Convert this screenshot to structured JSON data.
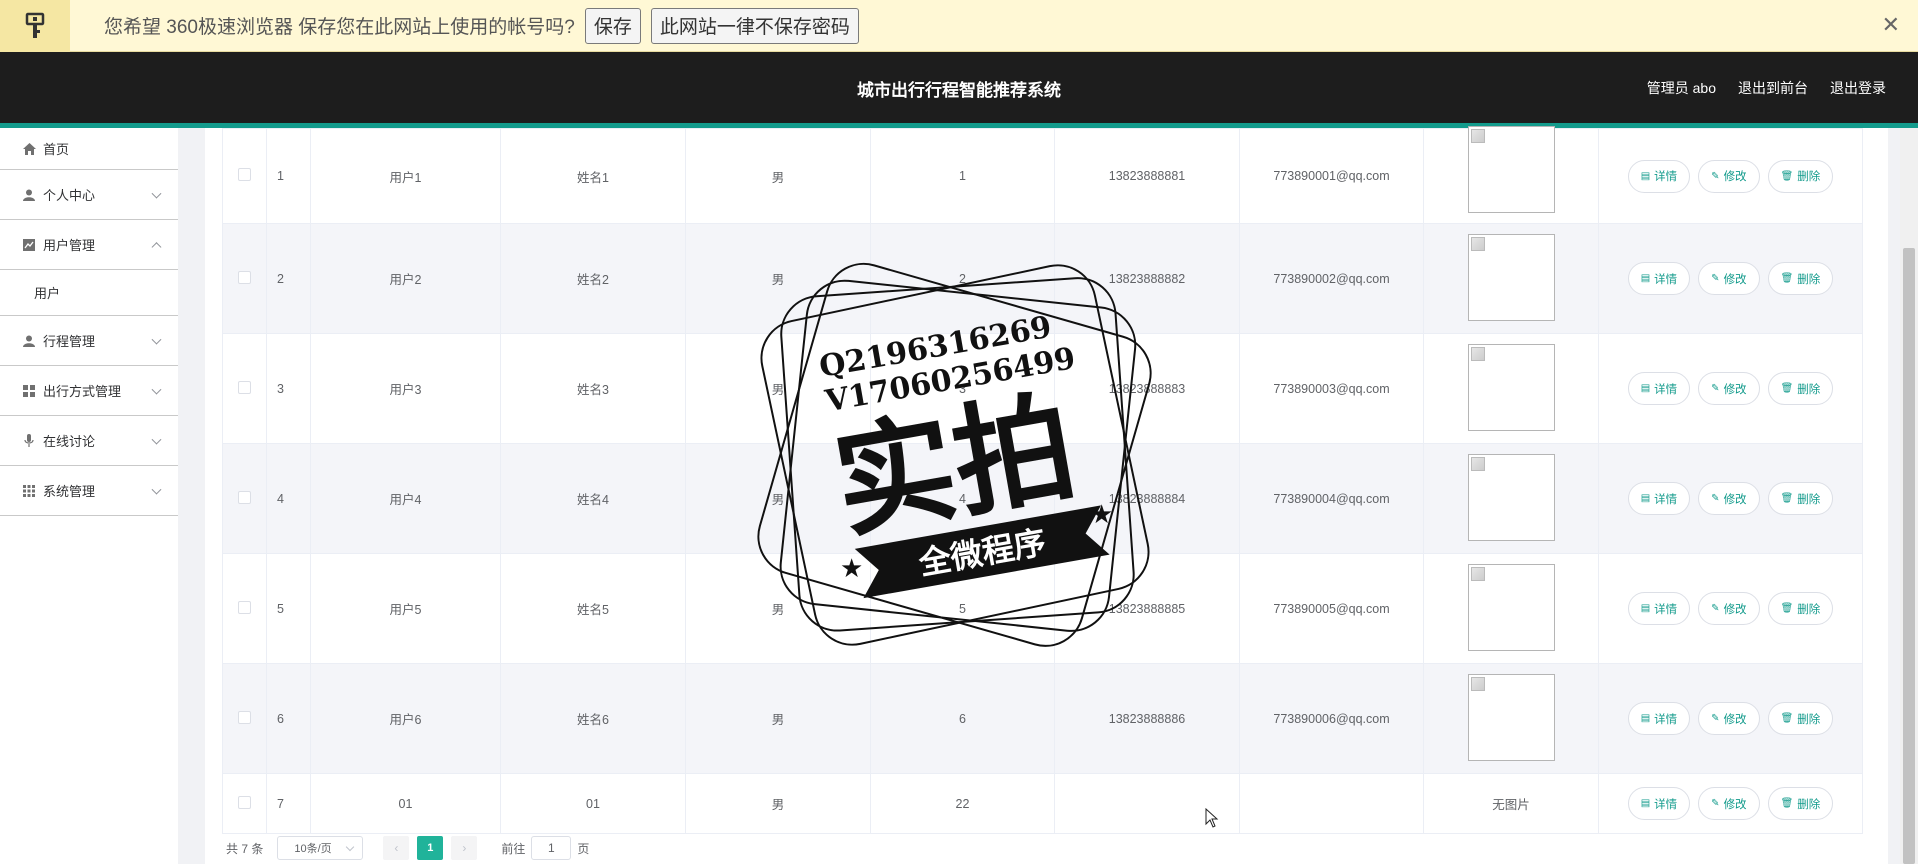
{
  "password_bar": {
    "message": "您希望 360极速浏览器 保存您在此网站上使用的帐号吗?",
    "save_label": "保存",
    "never_label": "此网站一律不保存密码",
    "close": "✕"
  },
  "header": {
    "title": "城市出行行程智能推荐系统",
    "admin": "管理员 abo",
    "to_front": "退出到前台",
    "logout": "退出登录"
  },
  "sidebar": {
    "home": "首页",
    "personal": "个人中心",
    "user_mgmt": "用户管理",
    "user_sub": "用户",
    "trip_mgmt": "行程管理",
    "mode_mgmt": "出行方式管理",
    "discussion": "在线讨论",
    "system_mgmt": "系统管理"
  },
  "table": {
    "no_image": "无图片",
    "ops": {
      "detail": "详情",
      "edit": "修改",
      "delete": "删除"
    },
    "rows": [
      {
        "idx": "1",
        "username": "用户1",
        "name": "姓名1",
        "gender": "男",
        "age": "1",
        "phone": "13823888881",
        "email": "773890001@qq.com"
      },
      {
        "idx": "2",
        "username": "用户2",
        "name": "姓名2",
        "gender": "男",
        "age": "2",
        "phone": "13823888882",
        "email": "773890002@qq.com"
      },
      {
        "idx": "3",
        "username": "用户3",
        "name": "姓名3",
        "gender": "男",
        "age": "3",
        "phone": "13823888883",
        "email": "773890003@qq.com"
      },
      {
        "idx": "4",
        "username": "用户4",
        "name": "姓名4",
        "gender": "男",
        "age": "4",
        "phone": "13823888884",
        "email": "773890004@qq.com"
      },
      {
        "idx": "5",
        "username": "用户5",
        "name": "姓名5",
        "gender": "男",
        "age": "5",
        "phone": "13823888885",
        "email": "773890005@qq.com"
      },
      {
        "idx": "6",
        "username": "用户6",
        "name": "姓名6",
        "gender": "男",
        "age": "6",
        "phone": "13823888886",
        "email": "773890006@qq.com"
      },
      {
        "idx": "7",
        "username": "01",
        "name": "01",
        "gender": "男",
        "age": "22",
        "phone": "",
        "email": ""
      }
    ]
  },
  "pager": {
    "total": "共 7 条",
    "size": "10条/页",
    "prev": "‹",
    "page": "1",
    "next": "›",
    "goto": "前往",
    "goto_value": "1",
    "page_suffix": "页"
  },
  "watermark": {
    "line1": "Q2196316269",
    "line2": "V17060256499",
    "main": "实拍",
    "banner": "全微程序"
  }
}
